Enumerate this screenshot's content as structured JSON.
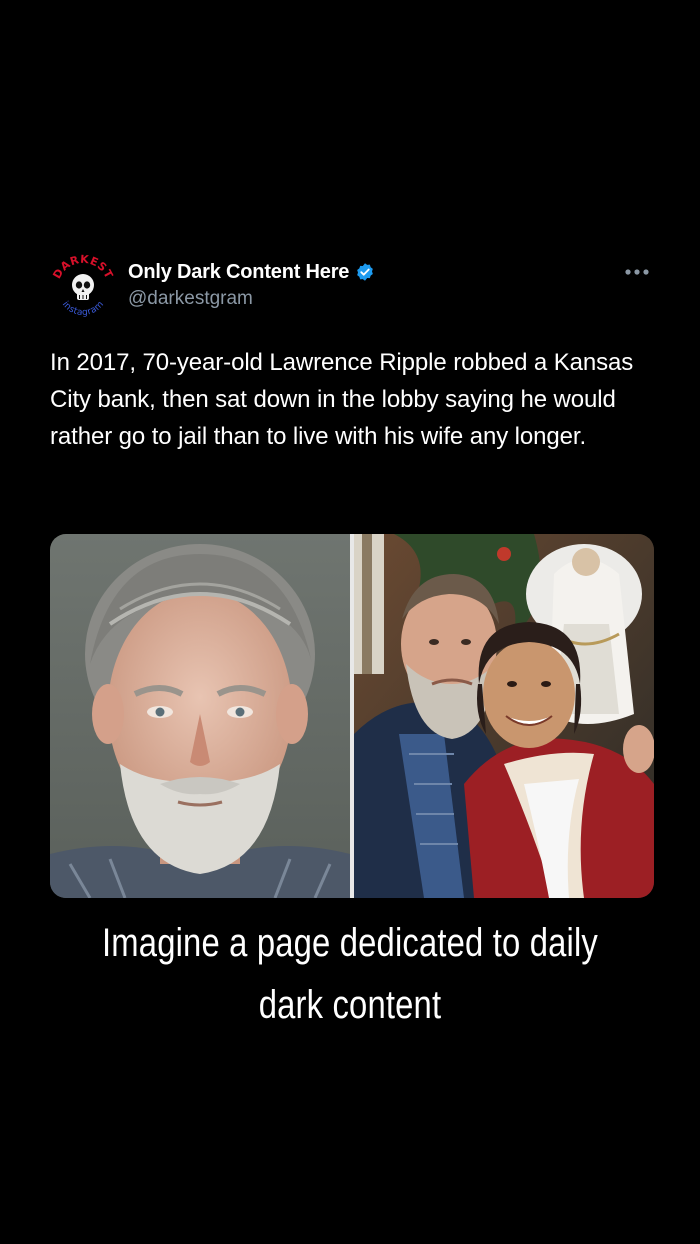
{
  "tweet": {
    "author": {
      "display_name": "Only Dark Content Here",
      "handle": "@darkestgram",
      "verified": true,
      "avatar_icon": "skull-logo-icon",
      "avatar_logo_text_top": "DARKEST",
      "avatar_logo_text_bottom": "instagram"
    },
    "more_icon": "more-horizontal-icon",
    "text": "In 2017, 70-year-old Lawrence Ripple robbed a Kansas City bank, then sat down in the lobby saying he would rather go to jail than to live with his wife any longer.",
    "media": {
      "left_image": "mugshot-photo",
      "right_image": "couple-photo"
    }
  },
  "caption": {
    "line1": "Imagine a page dedicated to daily",
    "line2": "dark content"
  },
  "colors": {
    "background": "#000000",
    "text_primary": "#ffffff",
    "text_secondary": "#8b98a5",
    "verified_blue": "#1d9bf0",
    "logo_red": "#d8102a",
    "logo_blue": "#3b5bdb"
  }
}
